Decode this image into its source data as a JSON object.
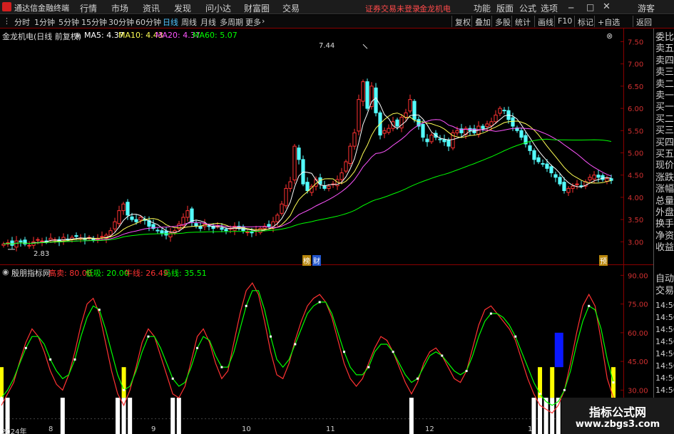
{
  "menubar": {
    "app_title": "通达信金融终端",
    "menus": [
      "行情",
      "市场",
      "资讯",
      "发现",
      "问小达",
      "财富圈",
      "交易"
    ],
    "notice": "证券交易未登录",
    "stock": "金龙机电",
    "right_menus": [
      "功能",
      "版面",
      "公式",
      "选项"
    ],
    "guest": "游客"
  },
  "toolbar": {
    "periods": [
      "分时",
      "1分钟",
      "5分钟",
      "15分钟",
      "30分钟",
      "60分钟",
      "日线",
      "周线",
      "月线",
      "多周期",
      "更多"
    ],
    "active_period": "日线",
    "tools": [
      "复权",
      "叠加",
      "多股",
      "统计",
      "画线",
      "F10",
      "标记",
      "+自选",
      "返回"
    ]
  },
  "price_chart": {
    "title": "金龙机电(日线 前复权)",
    "ma5_label": "MA5: 4.37",
    "ma10_label": "MA10: 4.43",
    "ma20_label": "MA20: 4.37",
    "ma60_label": "MA60: 5.07",
    "high_marker": "7.44",
    "low_marker": "2.83",
    "event_tags": [
      "榜",
      "财",
      "预"
    ]
  },
  "indicator": {
    "name": "殷朋指标网",
    "sell_label": "高卖: 80.00",
    "buy_label": "低吸: 20.00",
    "cow_label": "牛线: 26.49",
    "horse_label": "马线: 35.51"
  },
  "side_panel": {
    "items": [
      "委比",
      "卖五",
      "卖四",
      "卖三",
      "卖二",
      "卖一",
      "买一",
      "买二",
      "买三",
      "买四",
      "买五",
      "现价",
      "涨跌",
      "涨幅",
      "总量",
      "外盘",
      "换手",
      "净资",
      "收益"
    ],
    "lower_items": [
      "自动",
      "交易"
    ],
    "times": [
      "14:56",
      "14:56",
      "14:56",
      "14:56",
      "14:56",
      "14:56",
      "14:56",
      "14:56"
    ]
  },
  "x_axis": [
    "2024年",
    "8",
    "9",
    "10",
    "11",
    "12",
    "1"
  ],
  "watermark": {
    "title": "指标公式网",
    "url": "www.zbgs3.com"
  },
  "colors": {
    "up": "#ff3232",
    "down": "#54ffff",
    "ma5": "#ffffff",
    "ma10": "#ffff55",
    "ma20": "#ff55ff",
    "ma60": "#00ff00",
    "axis": "#8a0000"
  },
  "chart_data": [
    {
      "type": "candlestick",
      "title": "金龙机电(日线 前复权)",
      "ylim": [
        2.7,
        7.7
      ],
      "yticks": [
        3.0,
        3.5,
        4.0,
        4.5,
        5.0,
        5.5,
        6.0,
        6.5,
        7.0,
        7.5
      ],
      "close": [
        2.95,
        2.98,
        2.92,
        3.02,
        3.0,
        2.95,
        2.92,
        3.0,
        3.05,
        3.02,
        3.0,
        3.08,
        3.05,
        3.0,
        3.1,
        3.05,
        3.1,
        3.12,
        3.08,
        3.05,
        3.1,
        3.05,
        3.08,
        3.12,
        3.15,
        3.25,
        3.45,
        3.7,
        3.85,
        3.6,
        3.5,
        3.45,
        3.55,
        3.48,
        3.35,
        3.3,
        3.25,
        3.2,
        3.15,
        3.2,
        3.25,
        3.4,
        3.55,
        3.7,
        3.45,
        3.35,
        3.3,
        3.4,
        3.35,
        3.3,
        3.35,
        3.28,
        3.25,
        3.3,
        3.35,
        3.3,
        3.25,
        3.22,
        3.2,
        3.25,
        3.3,
        3.35,
        3.35,
        3.45,
        3.6,
        3.85,
        4.2,
        4.35,
        5.15,
        4.85,
        4.3,
        4.15,
        4.25,
        4.4,
        4.3,
        4.2,
        4.25,
        4.3,
        4.4,
        4.55,
        4.8,
        5.15,
        5.45,
        6.2,
        6.6,
        6.0,
        6.5,
        5.9,
        5.4,
        5.5,
        5.55,
        5.7,
        5.6,
        5.8,
        5.9,
        6.2,
        5.75,
        5.6,
        5.35,
        5.25,
        5.4,
        5.35,
        5.3,
        5.25,
        5.15,
        5.45,
        5.5,
        5.45,
        5.55,
        5.5,
        5.45,
        5.6,
        5.55,
        5.65,
        5.7,
        5.85,
        6.0,
        5.95,
        5.75,
        5.6,
        5.5,
        5.35,
        5.2,
        5.05,
        4.85,
        4.8,
        4.75,
        4.65,
        4.55,
        4.45,
        4.3,
        4.15,
        4.2,
        4.25,
        4.3,
        4.25,
        4.35,
        4.45,
        4.5,
        4.45,
        4.4,
        4.42,
        4.38
      ],
      "high_label": 7.44,
      "low_label": 2.83,
      "ma60_last": 5.07
    },
    {
      "type": "line",
      "title": "殷朋指标网",
      "ylim": [
        13,
        92
      ],
      "yticks": [
        15.0,
        30.0,
        45.0,
        60.0,
        75.0,
        90.0
      ],
      "series": [
        {
          "name": "牛线",
          "values": [
            22,
            28,
            34,
            45,
            55,
            62,
            58,
            50,
            40,
            33,
            30,
            38,
            50,
            64,
            75,
            78,
            70,
            55,
            40,
            28,
            22,
            30,
            42,
            55,
            62,
            58,
            48,
            38,
            28,
            26,
            32,
            45,
            58,
            62,
            55,
            44,
            36,
            40,
            55,
            70,
            82,
            86,
            80,
            66,
            50,
            38,
            36,
            44,
            56,
            66,
            74,
            78,
            80,
            76,
            68,
            56,
            44,
            36,
            32,
            36,
            44,
            52,
            58,
            56,
            50,
            42,
            34,
            28,
            34,
            44,
            50,
            52,
            48,
            42,
            36,
            34,
            40,
            52,
            64,
            72,
            74,
            70,
            66,
            62,
            56,
            46,
            36,
            28,
            22,
            20,
            18,
            22,
            30,
            44,
            60,
            74,
            80,
            74,
            56,
            36,
            26
          ]
        },
        {
          "name": "马线",
          "values": [
            26,
            30,
            36,
            44,
            52,
            58,
            58,
            54,
            46,
            40,
            36,
            38,
            46,
            58,
            68,
            74,
            72,
            62,
            50,
            38,
            30,
            32,
            40,
            50,
            58,
            58,
            52,
            44,
            36,
            32,
            34,
            42,
            52,
            58,
            56,
            48,
            42,
            42,
            50,
            62,
            74,
            82,
            82,
            72,
            58,
            46,
            42,
            46,
            54,
            62,
            70,
            74,
            76,
            76,
            70,
            60,
            50,
            42,
            38,
            38,
            42,
            50,
            54,
            54,
            50,
            44,
            38,
            34,
            36,
            42,
            48,
            50,
            48,
            44,
            40,
            38,
            40,
            48,
            58,
            66,
            70,
            70,
            68,
            64,
            58,
            50,
            42,
            34,
            28,
            24,
            22,
            24,
            30,
            40,
            54,
            66,
            74,
            72,
            62,
            46,
            34
          ]
        }
      ],
      "high_sell_level": 80.0,
      "low_buy_level": 20.0,
      "cow_last": 26.49,
      "horse_last": 35.51
    }
  ]
}
